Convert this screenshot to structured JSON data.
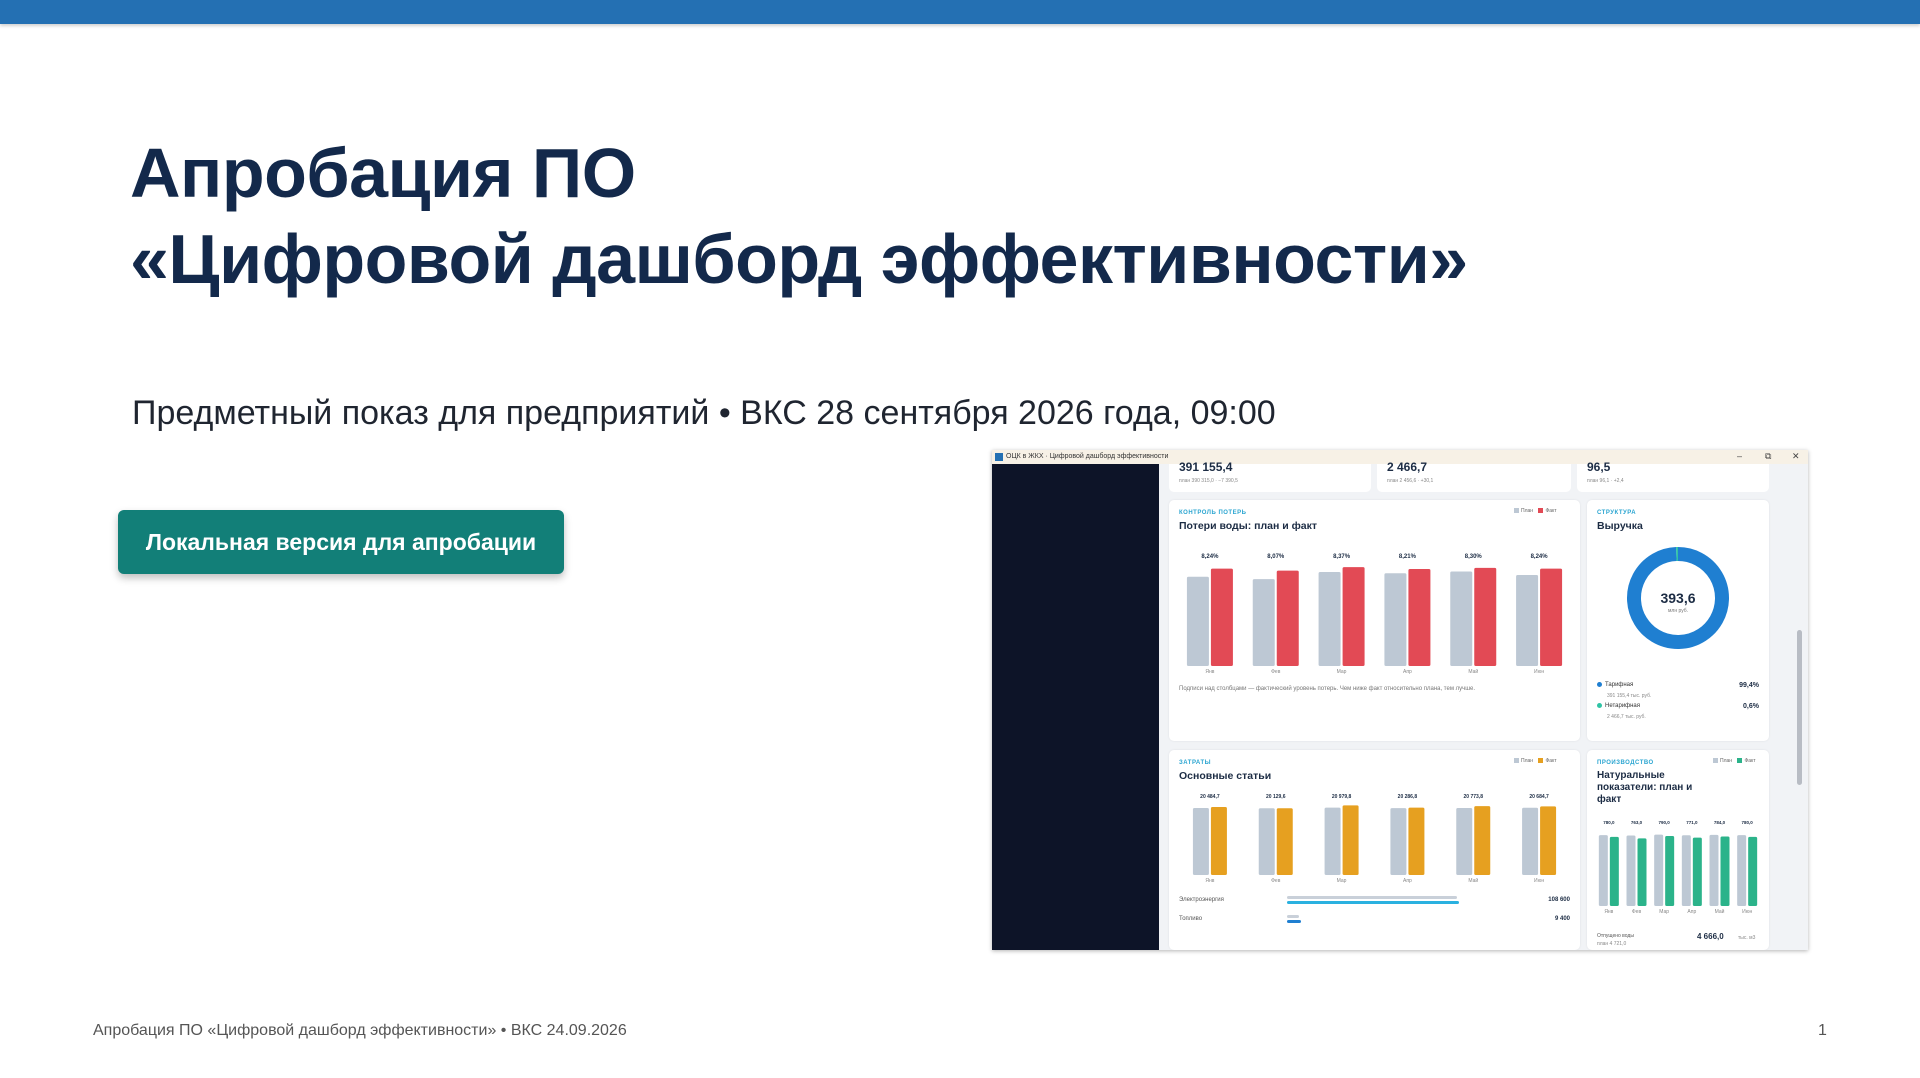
{
  "slide": {
    "title_line1": "Апробация ПО",
    "title_line2": "«Цифровой дашборд эффективности»",
    "subtitle": "Предметный показ для предприятий • ВКС 28 сентября 2026 года, 09:00",
    "cta_label": "Локальная версия для апробации",
    "footer": "Апробация ПО «Цифровой дашборд эффективности» • ВКС 24.09.2026",
    "page_number": "1",
    "colors": {
      "top_bar": "#2470b3",
      "title": "#13294b",
      "cta": "#127f78"
    }
  },
  "screenshot": {
    "window_title": "ОЦК в ЖКХ · Цифровой дашборд эффективности",
    "window_controls": [
      "–",
      "⧉",
      "✕"
    ],
    "kpis": [
      {
        "value": "391 155,4",
        "sub": "план 390 315,0 · −7 390,5"
      },
      {
        "value": "2 466,7",
        "sub": "план 2 456,6 · +30,1"
      },
      {
        "value": "96,5",
        "sub": "план 96,1 · +2,4"
      }
    ],
    "losses": {
      "kicker": "КОНТРОЛЬ ПОТЕРЬ",
      "title": "Потери воды: план и факт",
      "legend": [
        "План",
        "Факт"
      ],
      "note": "Подписи над столбцами — фактический уровень потерь. Чем ниже факт относительно плана, тем лучше."
    },
    "revenue": {
      "kicker": "СТРУКТУРА",
      "title": "Выручка",
      "center_value": "393,6",
      "center_unit": "млн руб.",
      "items": [
        {
          "label": "Тарифная",
          "sub": "391 155,4 тыс. руб.",
          "pct": "99,4%",
          "color": "#1f7fd1"
        },
        {
          "label": "Нетарифная",
          "sub": "2 466,7 тыс. руб.",
          "pct": "0,6%",
          "color": "#2fc4a5"
        }
      ]
    },
    "costs": {
      "kicker": "ЗАТРАТЫ",
      "title": "Основные статьи",
      "legend": [
        "План",
        "Факт"
      ],
      "rows": [
        {
          "label": "Электроэнергия",
          "value": "108 600"
        },
        {
          "label": "Топливо",
          "value": "9 400"
        }
      ]
    },
    "production": {
      "kicker": "ПРОИЗВОДСТВО",
      "title_line1": "Натуральные",
      "title_line2": "показатели: план и",
      "title_line3": "факт",
      "legend": [
        "План",
        "Факт"
      ],
      "footer_label": "Отпущено воды",
      "footer_sub": "план 4 721,0",
      "footer_value": "4 666,0",
      "footer_unit": "тыс. м3"
    }
  },
  "chart_data": [
    {
      "type": "bar",
      "title": "Потери воды: план и факт",
      "categories": [
        "Янв",
        "Фев",
        "Мар",
        "Апр",
        "Май",
        "Июн"
      ],
      "series": [
        {
          "name": "План",
          "values": [
            7.55,
            7.35,
            7.95,
            7.85,
            8.0,
            7.7
          ],
          "color": "#bdc8d4"
        },
        {
          "name": "Факт",
          "values": [
            8.24,
            8.07,
            8.37,
            8.21,
            8.3,
            8.24
          ],
          "color": "#e24a55"
        }
      ],
      "labels": [
        "8,24%",
        "8,07%",
        "8,37%",
        "8,21%",
        "8,30%",
        "8,24%"
      ],
      "ylim": [
        0,
        8.8
      ]
    },
    {
      "type": "bar",
      "title": "Основные статьи",
      "categories": [
        "Янв",
        "Фев",
        "Мар",
        "Апр",
        "Май",
        "Июн"
      ],
      "series": [
        {
          "name": "План",
          "values": [
            20200,
            20100,
            20300,
            20150,
            20200,
            20250
          ],
          "color": "#bdc8d4"
        },
        {
          "name": "Факт",
          "values": [
            20484.7,
            20129.6,
            20979.8,
            20286.8,
            20773.8,
            20684.7
          ],
          "color": "#e6a020"
        }
      ],
      "labels": [
        "20 484,7",
        "20 129,6",
        "20 979,8",
        "20 286,8",
        "20 773,8",
        "20 684,7"
      ],
      "ylim": [
        0,
        22000
      ]
    },
    {
      "type": "bar",
      "title": "Натуральные показатели: план и факт",
      "categories": [
        "Янв",
        "Фев",
        "Мар",
        "Апр",
        "Май",
        "Июн"
      ],
      "series": [
        {
          "name": "План",
          "values": [
            800,
            795,
            805,
            798,
            802,
            800
          ],
          "color": "#bdc8d4"
        },
        {
          "name": "Факт",
          "values": [
            780,
            763,
            790,
            771,
            784,
            780
          ],
          "color": "#2bb38a"
        }
      ],
      "labels": [
        "780,0",
        "763,0",
        "790,0",
        "771,0",
        "784,0",
        "780,0"
      ],
      "ylim": [
        0,
        880
      ]
    },
    {
      "type": "pie",
      "title": "Выручка",
      "categories": [
        "Тарифная",
        "Нетарифная"
      ],
      "values": [
        99.4,
        0.6
      ],
      "colors": [
        "#1f7fd1",
        "#2fc4a5"
      ]
    }
  ]
}
